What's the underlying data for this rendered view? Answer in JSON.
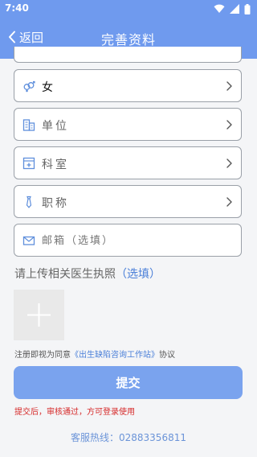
{
  "status_bar": {
    "time": "7:40"
  },
  "nav": {
    "back_label": "返回",
    "title": "完善资料"
  },
  "form": {
    "gender": {
      "value": "女",
      "icon": "gender-icon"
    },
    "unit": {
      "label": "单位",
      "icon": "building-icon"
    },
    "department": {
      "label": "科室",
      "icon": "department-icon"
    },
    "position": {
      "label": "职称",
      "icon": "tie-icon"
    },
    "email": {
      "placeholder": "邮箱（选填）",
      "value": "",
      "icon": "mail-icon"
    }
  },
  "upload": {
    "hint": "请上传相关医生执照",
    "optional": "（选填）"
  },
  "agreement": {
    "prefix": "注册即视为同意",
    "link": "《出生缺陷咨询工作站》",
    "suffix": "协议"
  },
  "submit": {
    "label": "提交",
    "note": "提交后，审核通过，方可登录使用"
  },
  "hotline": {
    "text": "客服热线：02883356811"
  },
  "colors": {
    "header": "#6f9aee",
    "button": "#7aa3ee",
    "link": "#4a7fd8",
    "warning": "#d62a2a"
  }
}
